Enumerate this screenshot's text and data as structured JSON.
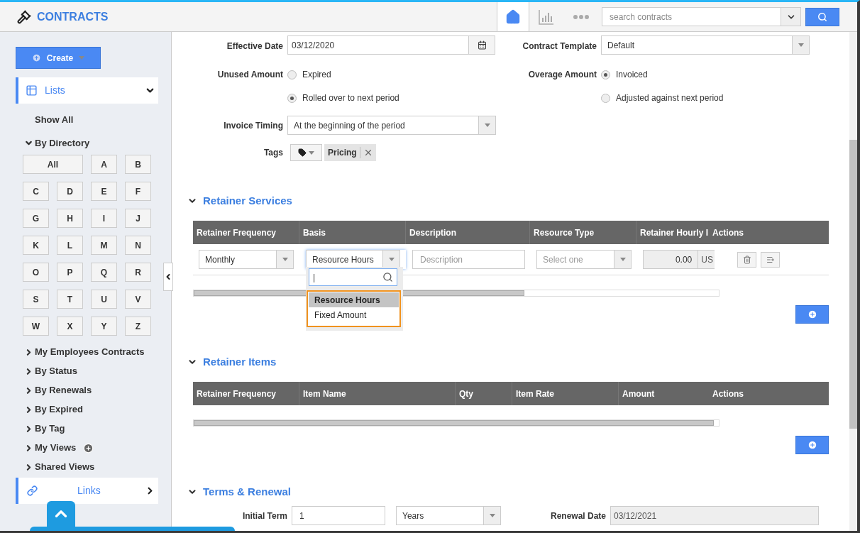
{
  "app": {
    "title": "CONTRACTS"
  },
  "search": {
    "placeholder": "search contracts"
  },
  "sidebar": {
    "create_button": "Create",
    "lists": {
      "label": "Lists",
      "expanded": true
    },
    "show_all": "Show All",
    "directory": {
      "label": "By Directory",
      "expanded": true,
      "letters": [
        "All",
        "A",
        "B",
        "C",
        "D",
        "E",
        "F",
        "G",
        "H",
        "I",
        "J",
        "K",
        "L",
        "M",
        "N",
        "O",
        "P",
        "Q",
        "R",
        "S",
        "T",
        "U",
        "V",
        "W",
        "X",
        "Y",
        "Z"
      ]
    },
    "items": [
      {
        "label": "My Employees Contracts",
        "expanded": false,
        "kind": "plain"
      },
      {
        "label": "By Status",
        "expanded": false,
        "kind": "plain"
      },
      {
        "label": "By Renewals",
        "expanded": false,
        "kind": "plain"
      },
      {
        "label": "By Expired",
        "expanded": false,
        "kind": "plain"
      },
      {
        "label": "By Tag",
        "expanded": false,
        "kind": "plain"
      },
      {
        "label": "My Views",
        "expanded": false,
        "kind": "addable"
      },
      {
        "label": "Shared Views",
        "expanded": false,
        "kind": "plain"
      }
    ],
    "links": {
      "label_end": "Links"
    }
  },
  "form": {
    "effective_date": {
      "label": "Effective Date",
      "value": "03/12/2020"
    },
    "contract_template": {
      "label": "Contract Template",
      "value": "Default"
    },
    "unused_amount": {
      "label": "Unused Amount",
      "options": [
        {
          "label": "Expired",
          "selected": false
        },
        {
          "label": "Rolled over to next period",
          "selected": true
        }
      ]
    },
    "overage_amount": {
      "label": "Overage Amount",
      "options": [
        {
          "label": "Invoiced",
          "selected": true
        },
        {
          "label": "Adjusted against next period",
          "selected": false
        }
      ]
    },
    "invoice_timing": {
      "label": "Invoice Timing",
      "value": "At the beginning of the period"
    },
    "tags": {
      "label": "Tags",
      "items": [
        "Pricing"
      ]
    }
  },
  "retainer_services": {
    "title": "Retainer Services",
    "expanded": true,
    "columns": [
      "Retainer Frequency",
      "Basis",
      "Description",
      "Resource Type",
      "Retainer Hourly I",
      "Actions"
    ],
    "row": {
      "frequency": "Monthly",
      "basis": "Resource Hours",
      "description_placeholder": "Description",
      "resource_type_placeholder": "Select one",
      "rate": "0.00",
      "currency": "US"
    },
    "basis_dropdown": {
      "search_value": "|",
      "options": [
        {
          "label": "Resource Hours",
          "selected": true
        },
        {
          "label": "Fixed Amount",
          "selected": false
        }
      ]
    }
  },
  "retainer_items": {
    "title": "Retainer Items",
    "expanded": true,
    "columns": [
      "Retainer Frequency",
      "Item Name",
      "Qty",
      "Item Rate",
      "Amount",
      "Actions"
    ]
  },
  "terms": {
    "title": "Terms & Renewal",
    "expanded": true,
    "initial_term": {
      "label": "Initial Term",
      "value": "1",
      "unit": "Years"
    },
    "renewal_date": {
      "label": "Renewal Date",
      "value": "03/12/2021"
    }
  }
}
